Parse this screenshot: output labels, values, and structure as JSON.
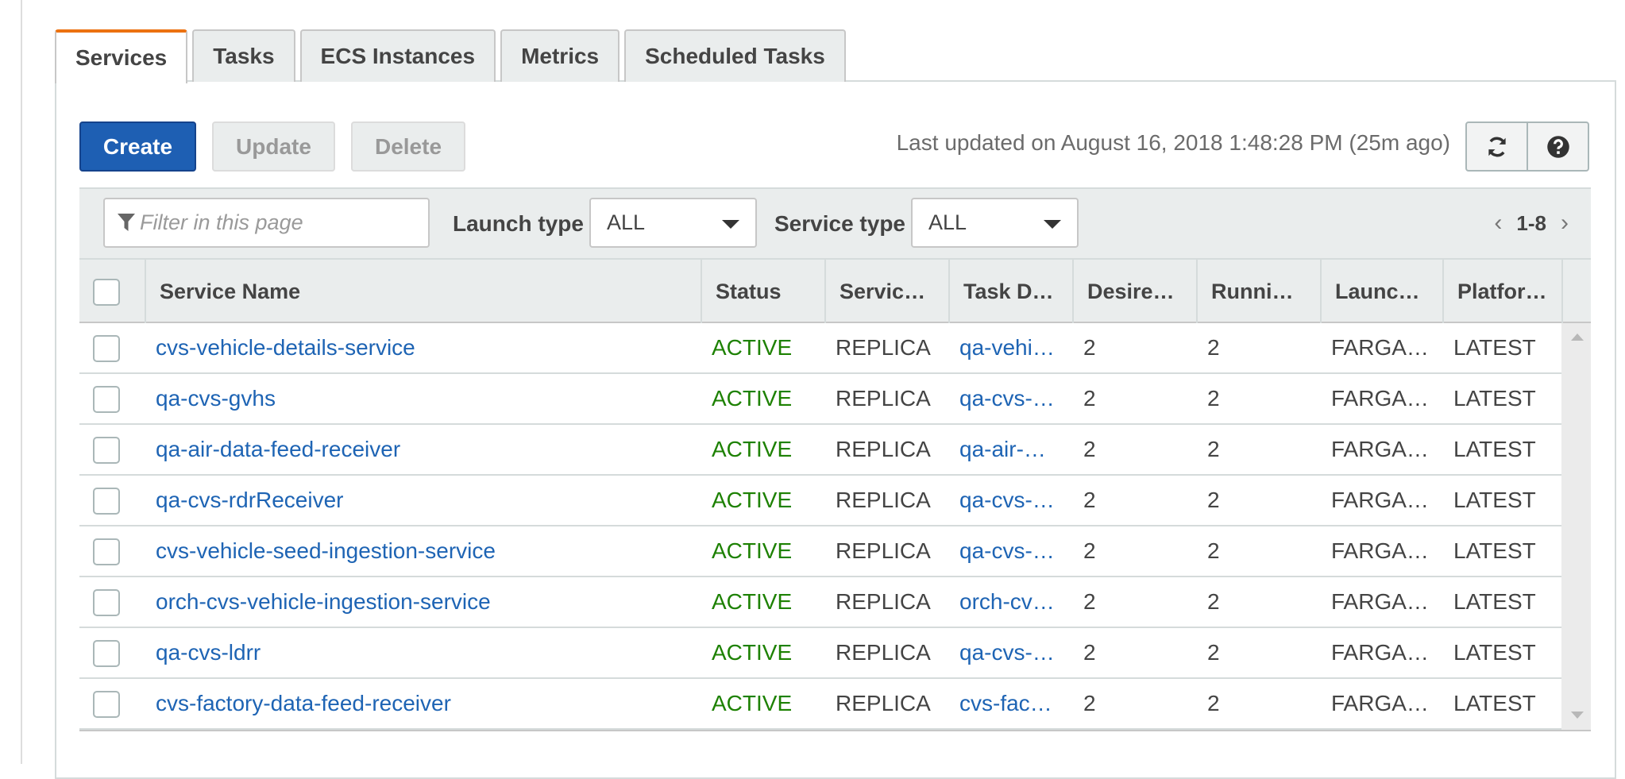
{
  "tabs": [
    {
      "label": "Services",
      "active": true
    },
    {
      "label": "Tasks",
      "active": false
    },
    {
      "label": "ECS Instances",
      "active": false
    },
    {
      "label": "Metrics",
      "active": false
    },
    {
      "label": "Scheduled Tasks",
      "active": false
    }
  ],
  "actions": {
    "create_label": "Create",
    "update_label": "Update",
    "delete_label": "Delete",
    "last_updated": "Last updated on August 16, 2018 1:48:28 PM (25m ago)",
    "refresh_icon": "refresh-icon",
    "help_icon": "help-icon"
  },
  "filter": {
    "placeholder": "Filter in this page",
    "filter_icon": "funnel-icon",
    "launch_type_label": "Launch type",
    "launch_type_value": "ALL",
    "service_type_label": "Service type",
    "service_type_value": "ALL",
    "page_range": "1-8"
  },
  "table": {
    "headers": [
      "Service Name",
      "Status",
      "Servic…",
      "Task D…",
      "Desire…",
      "Runni…",
      "Launc…",
      "Platfor…"
    ],
    "rows": [
      {
        "name": "cvs-vehicle-details-service",
        "status": "ACTIVE",
        "service_type": "REPLICA",
        "task_def": "qa-vehi…",
        "desired": "2",
        "running": "2",
        "launch": "FARGA…",
        "platform": "LATEST"
      },
      {
        "name": "qa-cvs-gvhs",
        "status": "ACTIVE",
        "service_type": "REPLICA",
        "task_def": "qa-cvs-…",
        "desired": "2",
        "running": "2",
        "launch": "FARGA…",
        "platform": "LATEST"
      },
      {
        "name": "qa-air-data-feed-receiver",
        "status": "ACTIVE",
        "service_type": "REPLICA",
        "task_def": "qa-air-…",
        "desired": "2",
        "running": "2",
        "launch": "FARGA…",
        "platform": "LATEST"
      },
      {
        "name": "qa-cvs-rdrReceiver",
        "status": "ACTIVE",
        "service_type": "REPLICA",
        "task_def": "qa-cvs-…",
        "desired": "2",
        "running": "2",
        "launch": "FARGA…",
        "platform": "LATEST"
      },
      {
        "name": "cvs-vehicle-seed-ingestion-service",
        "status": "ACTIVE",
        "service_type": "REPLICA",
        "task_def": "qa-cvs-…",
        "desired": "2",
        "running": "2",
        "launch": "FARGA…",
        "platform": "LATEST"
      },
      {
        "name": "orch-cvs-vehicle-ingestion-service",
        "status": "ACTIVE",
        "service_type": "REPLICA",
        "task_def": "orch-cv…",
        "desired": "2",
        "running": "2",
        "launch": "FARGA…",
        "platform": "LATEST"
      },
      {
        "name": "qa-cvs-ldrr",
        "status": "ACTIVE",
        "service_type": "REPLICA",
        "task_def": "qa-cvs-…",
        "desired": "2",
        "running": "2",
        "launch": "FARGA…",
        "platform": "LATEST"
      },
      {
        "name": "cvs-factory-data-feed-receiver",
        "status": "ACTIVE",
        "service_type": "REPLICA",
        "task_def": "cvs-fac…",
        "desired": "2",
        "running": "2",
        "launch": "FARGA…",
        "platform": "LATEST"
      }
    ]
  },
  "colors": {
    "tab_accent": "#ec7211",
    "primary_button": "#1e5fb3",
    "link": "#1e64b4",
    "status_active": "#1d8102"
  }
}
